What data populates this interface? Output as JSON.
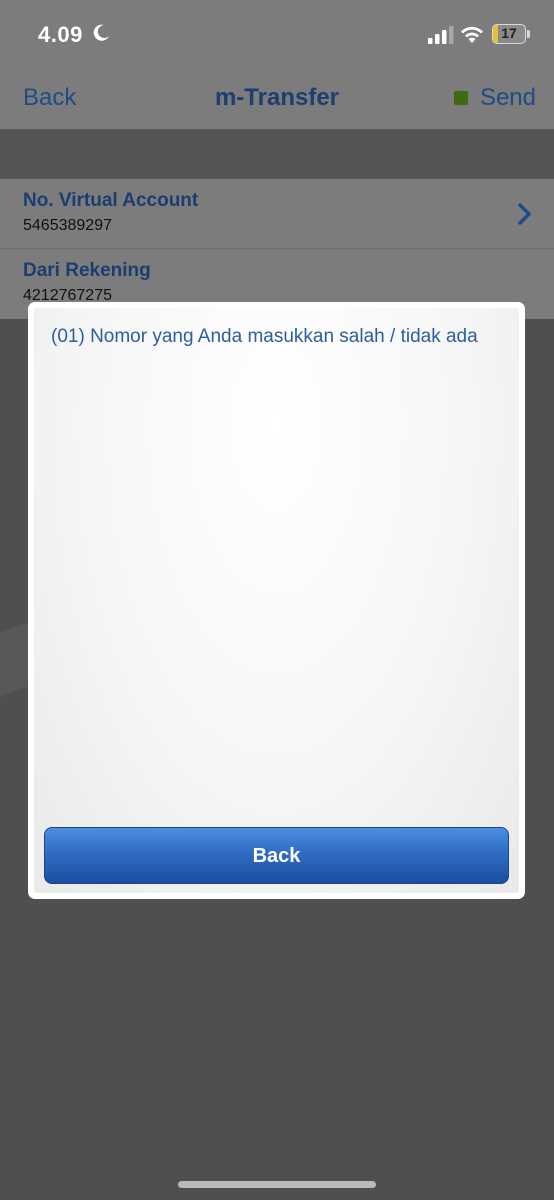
{
  "status_bar": {
    "time": "4.09",
    "battery_level": "17",
    "battery_fraction": 0.17
  },
  "nav": {
    "back_label": "Back",
    "title": "m-Transfer",
    "send_label": "Send"
  },
  "form": {
    "rows": [
      {
        "label": "No. Virtual Account",
        "value": "5465389297"
      },
      {
        "label": "Dari Rekening",
        "value": "4212767275"
      }
    ]
  },
  "dialog": {
    "message": "(01) Nomor yang Anda masukkan salah / tidak ada",
    "button_label": "Back"
  },
  "colors": {
    "accent_blue": "#2f6dc2",
    "title_blue": "#1c3e72",
    "send_indicator": "#3e6a14"
  }
}
